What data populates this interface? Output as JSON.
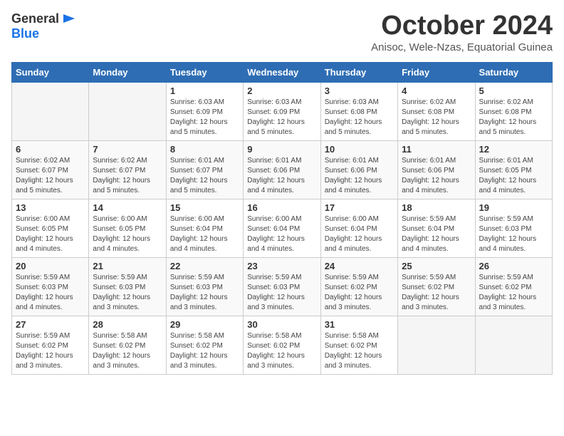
{
  "logo": {
    "general": "General",
    "blue": "Blue"
  },
  "title": "October 2024",
  "location": "Anisoc, Wele-Nzas, Equatorial Guinea",
  "weekdays": [
    "Sunday",
    "Monday",
    "Tuesday",
    "Wednesday",
    "Thursday",
    "Friday",
    "Saturday"
  ],
  "weeks": [
    [
      {
        "day": "",
        "info": ""
      },
      {
        "day": "",
        "info": ""
      },
      {
        "day": "1",
        "info": "Sunrise: 6:03 AM\nSunset: 6:09 PM\nDaylight: 12 hours and 5 minutes."
      },
      {
        "day": "2",
        "info": "Sunrise: 6:03 AM\nSunset: 6:09 PM\nDaylight: 12 hours and 5 minutes."
      },
      {
        "day": "3",
        "info": "Sunrise: 6:03 AM\nSunset: 6:08 PM\nDaylight: 12 hours and 5 minutes."
      },
      {
        "day": "4",
        "info": "Sunrise: 6:02 AM\nSunset: 6:08 PM\nDaylight: 12 hours and 5 minutes."
      },
      {
        "day": "5",
        "info": "Sunrise: 6:02 AM\nSunset: 6:08 PM\nDaylight: 12 hours and 5 minutes."
      }
    ],
    [
      {
        "day": "6",
        "info": "Sunrise: 6:02 AM\nSunset: 6:07 PM\nDaylight: 12 hours and 5 minutes."
      },
      {
        "day": "7",
        "info": "Sunrise: 6:02 AM\nSunset: 6:07 PM\nDaylight: 12 hours and 5 minutes."
      },
      {
        "day": "8",
        "info": "Sunrise: 6:01 AM\nSunset: 6:07 PM\nDaylight: 12 hours and 5 minutes."
      },
      {
        "day": "9",
        "info": "Sunrise: 6:01 AM\nSunset: 6:06 PM\nDaylight: 12 hours and 4 minutes."
      },
      {
        "day": "10",
        "info": "Sunrise: 6:01 AM\nSunset: 6:06 PM\nDaylight: 12 hours and 4 minutes."
      },
      {
        "day": "11",
        "info": "Sunrise: 6:01 AM\nSunset: 6:06 PM\nDaylight: 12 hours and 4 minutes."
      },
      {
        "day": "12",
        "info": "Sunrise: 6:01 AM\nSunset: 6:05 PM\nDaylight: 12 hours and 4 minutes."
      }
    ],
    [
      {
        "day": "13",
        "info": "Sunrise: 6:00 AM\nSunset: 6:05 PM\nDaylight: 12 hours and 4 minutes."
      },
      {
        "day": "14",
        "info": "Sunrise: 6:00 AM\nSunset: 6:05 PM\nDaylight: 12 hours and 4 minutes."
      },
      {
        "day": "15",
        "info": "Sunrise: 6:00 AM\nSunset: 6:04 PM\nDaylight: 12 hours and 4 minutes."
      },
      {
        "day": "16",
        "info": "Sunrise: 6:00 AM\nSunset: 6:04 PM\nDaylight: 12 hours and 4 minutes."
      },
      {
        "day": "17",
        "info": "Sunrise: 6:00 AM\nSunset: 6:04 PM\nDaylight: 12 hours and 4 minutes."
      },
      {
        "day": "18",
        "info": "Sunrise: 5:59 AM\nSunset: 6:04 PM\nDaylight: 12 hours and 4 minutes."
      },
      {
        "day": "19",
        "info": "Sunrise: 5:59 AM\nSunset: 6:03 PM\nDaylight: 12 hours and 4 minutes."
      }
    ],
    [
      {
        "day": "20",
        "info": "Sunrise: 5:59 AM\nSunset: 6:03 PM\nDaylight: 12 hours and 4 minutes."
      },
      {
        "day": "21",
        "info": "Sunrise: 5:59 AM\nSunset: 6:03 PM\nDaylight: 12 hours and 3 minutes."
      },
      {
        "day": "22",
        "info": "Sunrise: 5:59 AM\nSunset: 6:03 PM\nDaylight: 12 hours and 3 minutes."
      },
      {
        "day": "23",
        "info": "Sunrise: 5:59 AM\nSunset: 6:03 PM\nDaylight: 12 hours and 3 minutes."
      },
      {
        "day": "24",
        "info": "Sunrise: 5:59 AM\nSunset: 6:02 PM\nDaylight: 12 hours and 3 minutes."
      },
      {
        "day": "25",
        "info": "Sunrise: 5:59 AM\nSunset: 6:02 PM\nDaylight: 12 hours and 3 minutes."
      },
      {
        "day": "26",
        "info": "Sunrise: 5:59 AM\nSunset: 6:02 PM\nDaylight: 12 hours and 3 minutes."
      }
    ],
    [
      {
        "day": "27",
        "info": "Sunrise: 5:59 AM\nSunset: 6:02 PM\nDaylight: 12 hours and 3 minutes."
      },
      {
        "day": "28",
        "info": "Sunrise: 5:58 AM\nSunset: 6:02 PM\nDaylight: 12 hours and 3 minutes."
      },
      {
        "day": "29",
        "info": "Sunrise: 5:58 AM\nSunset: 6:02 PM\nDaylight: 12 hours and 3 minutes."
      },
      {
        "day": "30",
        "info": "Sunrise: 5:58 AM\nSunset: 6:02 PM\nDaylight: 12 hours and 3 minutes."
      },
      {
        "day": "31",
        "info": "Sunrise: 5:58 AM\nSunset: 6:02 PM\nDaylight: 12 hours and 3 minutes."
      },
      {
        "day": "",
        "info": ""
      },
      {
        "day": "",
        "info": ""
      }
    ]
  ]
}
